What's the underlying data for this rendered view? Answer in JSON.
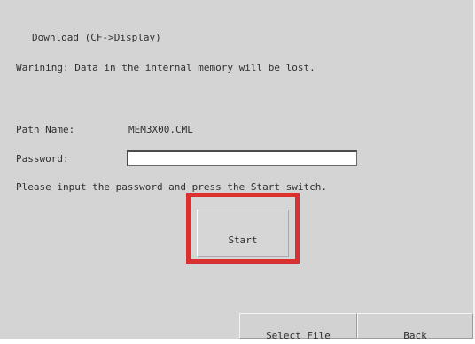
{
  "header": {
    "title": "Download (CF->Display)"
  },
  "warning": {
    "text": "Warining: Data in the internal memory will be lost."
  },
  "form": {
    "path_label": "Path Name:",
    "path_value": "MEM3X00.CML",
    "password_label": "Password:",
    "password_value": "",
    "instruction": "Please input the password and press the Start switch."
  },
  "actions": {
    "start_label": "Start",
    "select_file_label": "Select File",
    "back_label": "Back"
  },
  "colors": {
    "screen_background": "#d4d4d4",
    "highlight_border": "#d9312f"
  },
  "icons": []
}
